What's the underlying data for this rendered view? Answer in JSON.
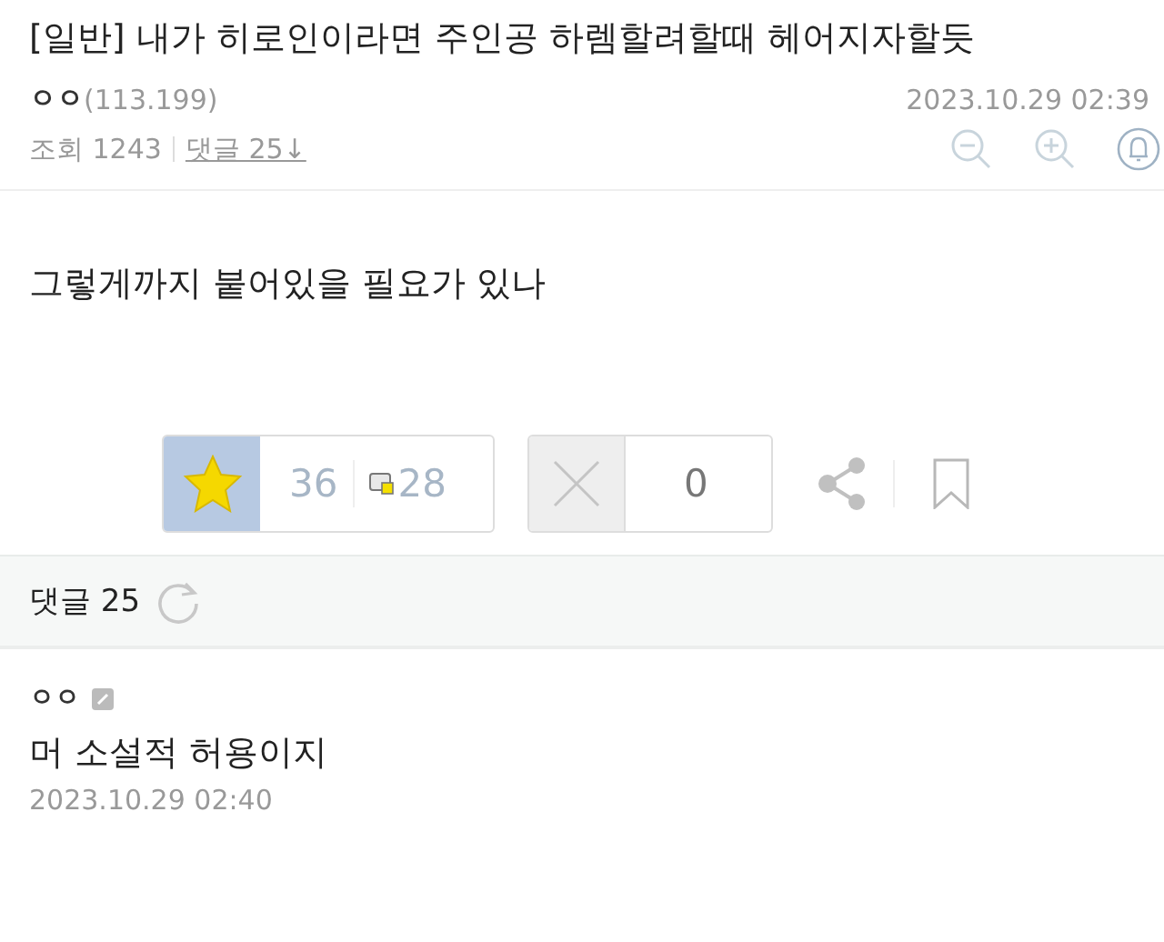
{
  "post": {
    "title": "[일반] 내가 히로인이라면 주인공 하렘할려할때 헤어지자할듯",
    "author": "ㅇㅇ",
    "ip": "(113.199)",
    "date": "2023.10.29 02:39",
    "views_label": "조회 1243",
    "comments_link": "댓글 25↓",
    "body": "그렇게까지 붙어있을 필요가 있나"
  },
  "votes": {
    "up_count": "36",
    "fixed_count": "28",
    "down_count": "0"
  },
  "comments": {
    "header": "댓글 25",
    "items": [
      {
        "author": "ㅇㅇ",
        "text": "머 소설적 허용이지",
        "date": "2023.10.29 02:40"
      }
    ]
  }
}
